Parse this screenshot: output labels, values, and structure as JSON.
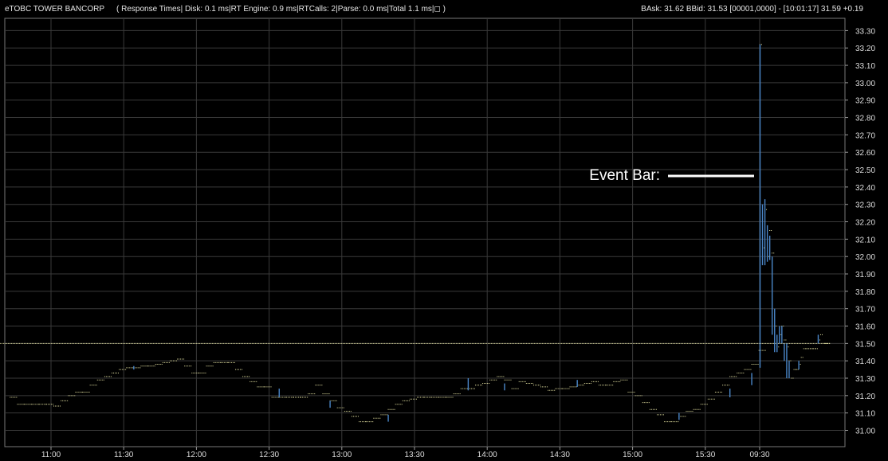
{
  "header": {
    "symbol": "eTOBC TOWER BANCORP",
    "response_times": "( Response Times| Disk: 0.1 ms|RT Engine: 0.9 ms|RTCalls: 2|Parse: 0.0 ms|Total 1.1 ms|◻ )",
    "quote": "BAsk: 31.62  BBid: 31.53  [00001,0000]  -  [10:01:17]  31.59  +0.19"
  },
  "colors": {
    "background": "#000000",
    "grid": "#3a3a3a",
    "price_dots": "#e2dfa0",
    "bars": "#4a86c8",
    "text": "#e6e6e6",
    "event_marker": "#ffffff"
  },
  "annotation": {
    "text": "Event Bar:"
  },
  "chart_data": {
    "type": "line",
    "title": "",
    "xlabel": "",
    "ylabel": "",
    "ylim": [
      30.97,
      33.35
    ],
    "grid": true,
    "y_axis_side": "right",
    "x_ticks": [
      "11:00",
      "11:30",
      "12:00",
      "12:30",
      "13:00",
      "13:30",
      "14:00",
      "14:30",
      "15:00",
      "15:30",
      "09:30"
    ],
    "y_ticks": [
      "31.00",
      "31.10",
      "31.20",
      "31.30",
      "31.40",
      "31.50",
      "31.60",
      "31.70",
      "31.80",
      "31.90",
      "32.00",
      "32.10",
      "32.20",
      "32.30",
      "32.40",
      "32.50",
      "32.60",
      "32.70",
      "32.80",
      "32.90",
      "33.00",
      "33.10",
      "33.20",
      "33.30"
    ],
    "series": [
      {
        "x": [
          "10:43",
          "10:46",
          "10:49",
          "10:52",
          "10:55",
          "10:58",
          "11:01",
          "11:04",
          "11:07",
          "11:10",
          "11:13",
          "11:16",
          "11:19",
          "11:22",
          "11:25",
          "11:28",
          "11:31",
          "11:34",
          "11:37",
          "11:40",
          "11:43",
          "11:46",
          "11:49",
          "11:52",
          "11:55",
          "11:58",
          "12:01",
          "12:04",
          "12:07",
          "12:10",
          "12:13",
          "12:16",
          "12:19",
          "12:22",
          "12:25",
          "12:28",
          "12:31",
          "12:34",
          "12:37",
          "12:40",
          "12:43",
          "12:46",
          "12:49",
          "12:52",
          "12:55",
          "12:58",
          "13:01",
          "13:04",
          "13:07",
          "13:10",
          "13:13",
          "13:16",
          "13:19",
          "13:22",
          "13:25",
          "13:28",
          "13:31",
          "13:34",
          "13:37",
          "13:40",
          "13:43",
          "13:46",
          "13:49",
          "13:52",
          "13:55",
          "13:58",
          "14:01",
          "14:04",
          "14:07",
          "14:10",
          "14:13",
          "14:16",
          "14:19",
          "14:22",
          "14:25",
          "14:28",
          "14:31",
          "14:34",
          "14:37",
          "14:40",
          "14:43",
          "14:46",
          "14:49",
          "14:52",
          "14:55",
          "14:58",
          "15:01",
          "15:04",
          "15:07",
          "15:10",
          "15:13",
          "15:16",
          "15:19",
          "15:22",
          "15:25",
          "15:28",
          "15:31",
          "15:34",
          "15:37",
          "15:40",
          "15:43",
          "15:46",
          "15:49",
          "15:52"
        ],
        "y": [
          31.19,
          31.15,
          31.15,
          31.15,
          31.15,
          31.15,
          31.14,
          31.17,
          31.2,
          31.22,
          31.22,
          31.26,
          31.29,
          31.31,
          31.33,
          31.35,
          31.36,
          31.36,
          31.37,
          31.37,
          31.38,
          31.39,
          31.4,
          31.41,
          31.37,
          31.33,
          31.33,
          31.37,
          31.39,
          31.39,
          31.39,
          31.35,
          31.31,
          31.28,
          31.25,
          31.25,
          31.19,
          31.19,
          31.19,
          31.19,
          31.19,
          31.21,
          31.26,
          31.21,
          31.17,
          31.13,
          31.11,
          31.08,
          31.05,
          31.05,
          31.07,
          31.09,
          31.12,
          31.15,
          31.17,
          31.18,
          31.19,
          31.19,
          31.19,
          31.19,
          31.19,
          31.21,
          31.24,
          31.24,
          31.26,
          31.27,
          31.29,
          31.31,
          31.29,
          31.24,
          31.28,
          31.27,
          31.26,
          31.25,
          31.23,
          31.24,
          31.24,
          31.25,
          31.26,
          31.27,
          31.28,
          31.26,
          31.26,
          31.28,
          31.29,
          31.22,
          31.2,
          31.16,
          31.12,
          31.09,
          31.05,
          31.05,
          31.08,
          31.11,
          31.12,
          31.15,
          31.18,
          31.22,
          31.26,
          31.31,
          31.33,
          31.35,
          31.38,
          31.46
        ]
      },
      {
        "x": [
          "09:30",
          "09:31",
          "09:32",
          "09:33",
          "09:34",
          "09:35",
          "09:36",
          "09:37",
          "09:38",
          "09:39",
          "09:40",
          "09:41",
          "09:42",
          "09:43",
          "09:44",
          "09:45",
          "09:46",
          "09:47",
          "09:48",
          "09:49",
          "09:50",
          "09:51",
          "09:52",
          "09:53",
          "09:54",
          "09:55",
          "09:56",
          "09:57",
          "09:58",
          "09:59",
          "10:00",
          "10:01"
        ],
        "y": [
          33.22,
          32.05,
          32.27,
          32.0,
          32.15,
          32.02,
          31.6,
          31.48,
          31.55,
          31.6,
          31.52,
          31.48,
          31.4,
          31.3,
          31.35,
          31.35,
          31.38,
          31.42,
          31.47,
          31.47,
          31.47,
          31.47,
          31.47,
          31.47,
          31.52,
          31.55,
          31.5,
          31.5,
          31.5,
          31.5,
          31.58,
          31.59
        ],
        "range_bars": [
          {
            "time": "09:30",
            "low": 31.36,
            "high": 33.22
          },
          {
            "time": "09:31",
            "low": 31.95,
            "high": 32.3
          },
          {
            "time": "09:32",
            "low": 31.95,
            "high": 32.33
          },
          {
            "time": "09:33",
            "low": 31.97,
            "high": 32.18
          },
          {
            "time": "09:34",
            "low": 31.98,
            "high": 32.12
          },
          {
            "time": "09:35",
            "low": 31.55,
            "high": 32.0
          },
          {
            "time": "09:36",
            "low": 31.45,
            "high": 31.7
          },
          {
            "time": "09:37",
            "low": 31.45,
            "high": 31.55
          },
          {
            "time": "09:38",
            "low": 31.5,
            "high": 31.6
          },
          {
            "time": "09:39",
            "low": 31.5,
            "high": 31.6
          },
          {
            "time": "09:40",
            "low": 31.4,
            "high": 31.5
          },
          {
            "time": "09:41",
            "low": 31.3,
            "high": 31.5
          },
          {
            "time": "09:42",
            "low": 31.3,
            "high": 31.4
          },
          {
            "time": "09:46",
            "low": 31.35,
            "high": 31.4
          },
          {
            "time": "09:54",
            "low": 31.5,
            "high": 31.55
          }
        ]
      }
    ],
    "spikes": [
      {
        "time": "11:34",
        "low": 31.35,
        "high": 31.37
      },
      {
        "time": "12:34",
        "low": 31.19,
        "high": 31.24
      },
      {
        "time": "12:55",
        "low": 31.13,
        "high": 31.17
      },
      {
        "time": "13:19",
        "low": 31.05,
        "high": 31.09
      },
      {
        "time": "13:52",
        "low": 31.23,
        "high": 31.3
      },
      {
        "time": "14:07",
        "low": 31.23,
        "high": 31.27
      },
      {
        "time": "14:37",
        "low": 31.25,
        "high": 31.29
      },
      {
        "time": "15:19",
        "low": 31.06,
        "high": 31.1
      },
      {
        "time": "15:40",
        "low": 31.19,
        "high": 31.24
      },
      {
        "time": "15:49",
        "low": 31.26,
        "high": 31.33
      }
    ],
    "event_bar_time": "09:30"
  }
}
